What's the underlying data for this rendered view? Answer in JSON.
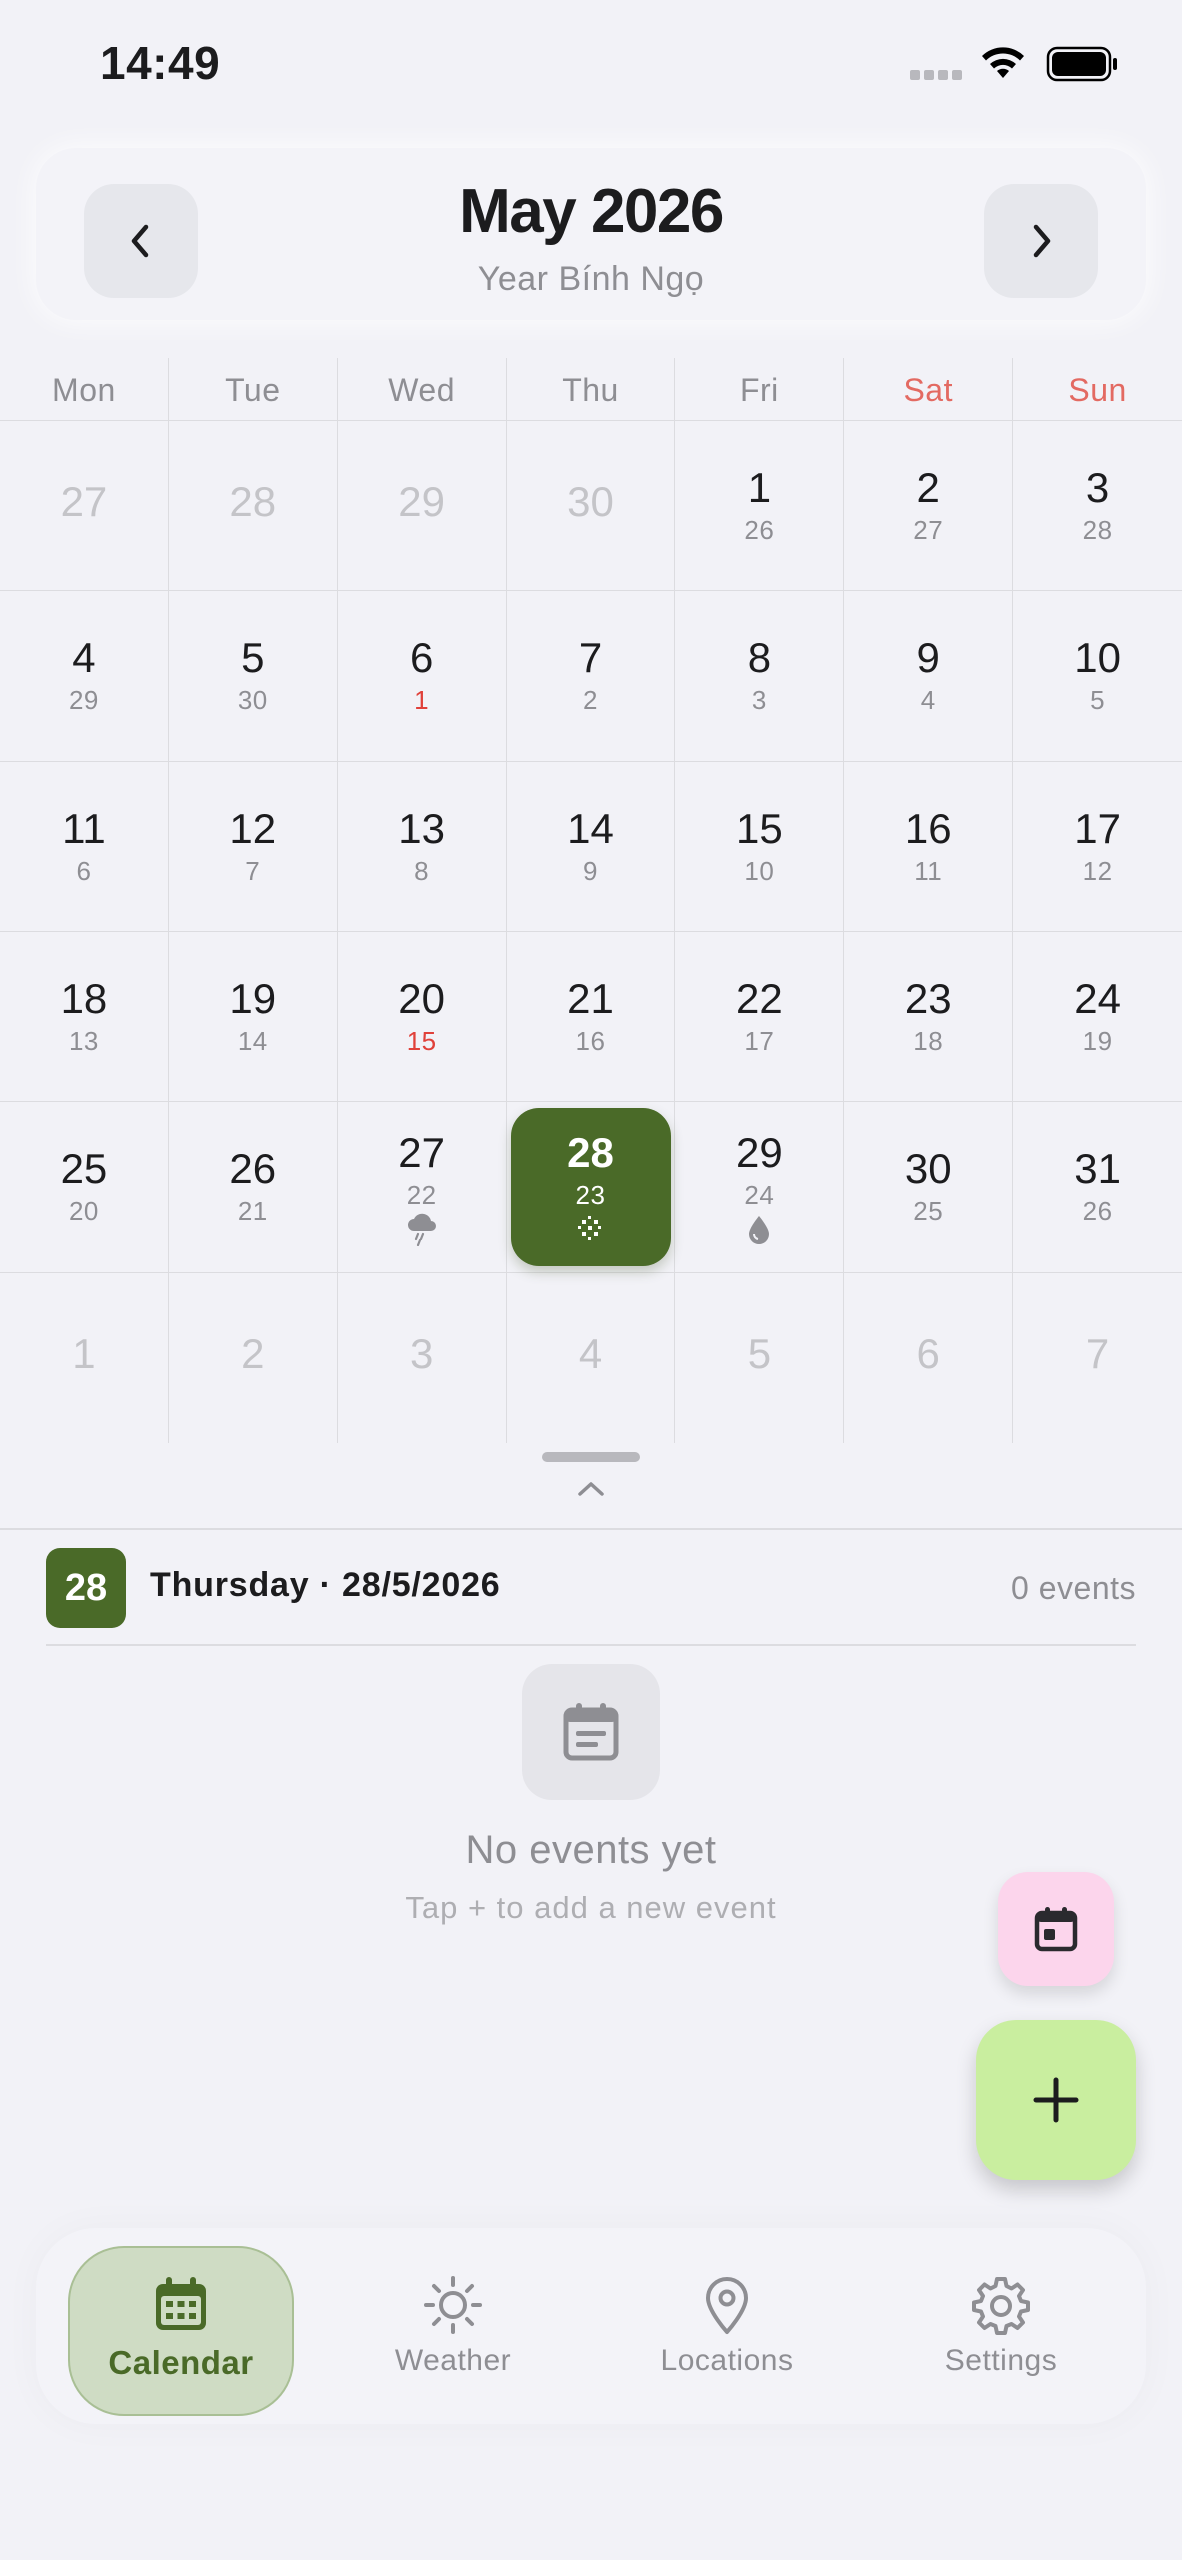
{
  "status": {
    "time": "14:49"
  },
  "header": {
    "month_title": "May 2026",
    "subtitle": "Year Bính Ngọ",
    "prev_icon": "chevron-left-icon",
    "next_icon": "chevron-right-icon"
  },
  "weekdays": [
    "Mon",
    "Tue",
    "Wed",
    "Thu",
    "Fri",
    "Sat",
    "Sun"
  ],
  "weeks": [
    [
      {
        "day": "27",
        "lunar": "",
        "dim": true
      },
      {
        "day": "28",
        "lunar": "",
        "dim": true
      },
      {
        "day": "29",
        "lunar": "",
        "dim": true
      },
      {
        "day": "30",
        "lunar": "",
        "dim": true
      },
      {
        "day": "1",
        "lunar": "26"
      },
      {
        "day": "2",
        "lunar": "27"
      },
      {
        "day": "3",
        "lunar": "28"
      }
    ],
    [
      {
        "day": "4",
        "lunar": "29"
      },
      {
        "day": "5",
        "lunar": "30"
      },
      {
        "day": "6",
        "lunar": "1",
        "lunar_red": true
      },
      {
        "day": "7",
        "lunar": "2"
      },
      {
        "day": "8",
        "lunar": "3"
      },
      {
        "day": "9",
        "lunar": "4"
      },
      {
        "day": "10",
        "lunar": "5"
      }
    ],
    [
      {
        "day": "11",
        "lunar": "6"
      },
      {
        "day": "12",
        "lunar": "7"
      },
      {
        "day": "13",
        "lunar": "8"
      },
      {
        "day": "14",
        "lunar": "9"
      },
      {
        "day": "15",
        "lunar": "10"
      },
      {
        "day": "16",
        "lunar": "11"
      },
      {
        "day": "17",
        "lunar": "12"
      }
    ],
    [
      {
        "day": "18",
        "lunar": "13"
      },
      {
        "day": "19",
        "lunar": "14"
      },
      {
        "day": "20",
        "lunar": "15",
        "lunar_red": true
      },
      {
        "day": "21",
        "lunar": "16"
      },
      {
        "day": "22",
        "lunar": "17"
      },
      {
        "day": "23",
        "lunar": "18"
      },
      {
        "day": "24",
        "lunar": "19"
      }
    ],
    [
      {
        "day": "25",
        "lunar": "20"
      },
      {
        "day": "26",
        "lunar": "21"
      },
      {
        "day": "27",
        "lunar": "22",
        "icon": "thunderstorm-icon"
      },
      {
        "day": "28",
        "lunar": "23",
        "icon": "snow-icon",
        "selected": true
      },
      {
        "day": "29",
        "lunar": "24",
        "icon": "raindrop-icon"
      },
      {
        "day": "30",
        "lunar": "25"
      },
      {
        "day": "31",
        "lunar": "26"
      }
    ],
    [
      {
        "day": "1",
        "lunar": "",
        "dim": true
      },
      {
        "day": "2",
        "lunar": "",
        "dim": true
      },
      {
        "day": "3",
        "lunar": "",
        "dim": true
      },
      {
        "day": "4",
        "lunar": "",
        "dim": true
      },
      {
        "day": "5",
        "lunar": "",
        "dim": true
      },
      {
        "day": "6",
        "lunar": "",
        "dim": true
      },
      {
        "day": "7",
        "lunar": "",
        "dim": true
      }
    ]
  ],
  "selected_day": {
    "badge": "28",
    "label": "Thursday · 28/5/2026",
    "events_count": "0 events"
  },
  "empty_state": {
    "title": "No events yet",
    "subtitle": "Tap + to add a new event"
  },
  "fabs": {
    "today_icon": "calendar-today-icon",
    "add_icon": "plus-icon"
  },
  "bottom_nav": [
    {
      "label": "Calendar",
      "icon": "calendar-icon",
      "active": true
    },
    {
      "label": "Weather",
      "icon": "sun-icon"
    },
    {
      "label": "Locations",
      "icon": "location-pin-icon"
    },
    {
      "label": "Settings",
      "icon": "gear-icon"
    }
  ],
  "colors": {
    "accent": "#4a6a28",
    "background": "#f2f2f7",
    "weekend": "#e36a62",
    "lunar_red": "#e0413a",
    "fab_add": "#c9ee9f",
    "fab_today": "#fcd5ec"
  }
}
